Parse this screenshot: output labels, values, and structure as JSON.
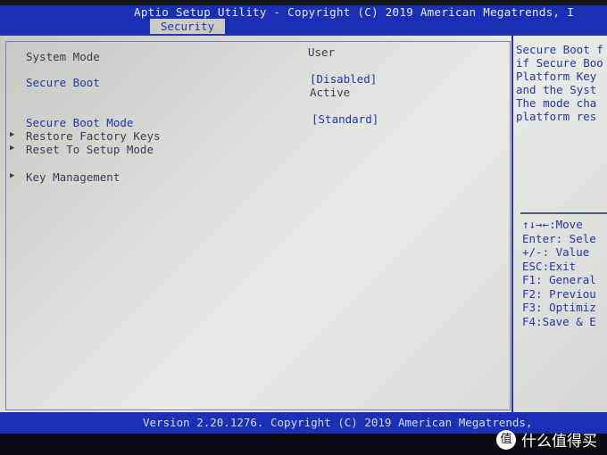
{
  "header": {
    "title": "Aptio Setup Utility - Copyright (C) 2019 American Megatrends, I",
    "tab": "Security"
  },
  "settings": [
    {
      "label": "System Mode",
      "value": "User"
    },
    {
      "label": "Secure Boot",
      "value": "[Disabled]",
      "value2": "Active"
    },
    {
      "label": "Secure Boot Mode",
      "value": "[Standard]"
    },
    {
      "label": "Restore Factory Keys"
    },
    {
      "label": "Reset To Setup Mode"
    },
    {
      "label": "Key Management"
    }
  ],
  "submenu_marker": "▶",
  "help": [
    "Secure Boot f",
    "if Secure Boo",
    "Platform Key",
    "and the Syst",
    "The mode cha",
    "platform res"
  ],
  "keys": [
    "↑↓→←:Move",
    "Enter: Sele",
    "+/-: Value",
    "ESC:Exit",
    "F1: General",
    "F2: Previou",
    "F3: Optimiz",
    "F4:Save & E"
  ],
  "footer": "Version 2.20.1276. Copyright (C) 2019 American Megatrends,",
  "watermark": {
    "icon": "值",
    "text": "什么值得买"
  },
  "colors": {
    "header_bg": "#1b2fb5",
    "panel_bg": "#d8dbd5",
    "accent_text": "#2734b0"
  }
}
